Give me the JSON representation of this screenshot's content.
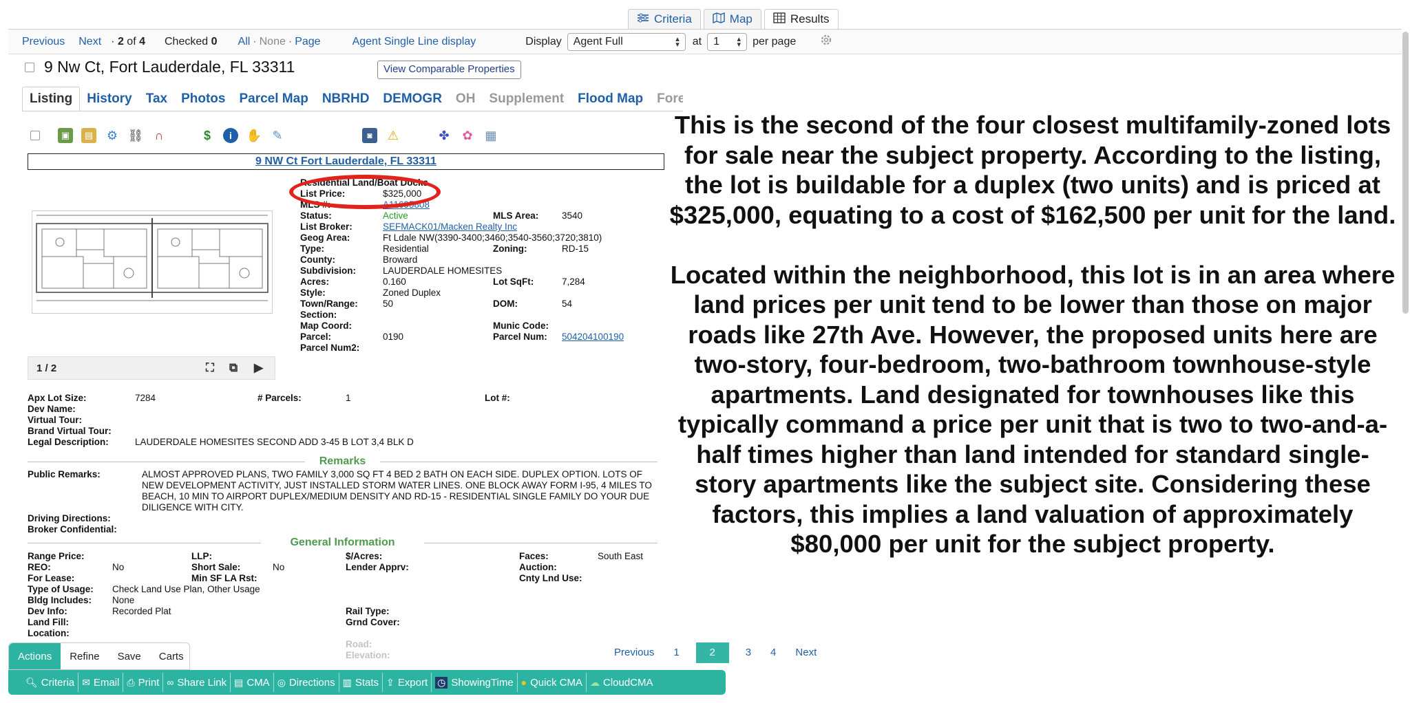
{
  "view_tabs": [
    {
      "label": "Criteria",
      "icon": "sliders-icon"
    },
    {
      "label": "Map",
      "icon": "map-icon"
    },
    {
      "label": "Results",
      "icon": "table-icon"
    }
  ],
  "nav": {
    "previous": "Previous",
    "next": "Next",
    "position_prefix": "·",
    "position_current": "2",
    "position_of": "of",
    "position_total": "4",
    "checked_label": "Checked",
    "checked_count": "0",
    "select_all": "All",
    "select_none": "None",
    "select_page": "Page",
    "dot": "·",
    "single_line": "Agent Single Line display",
    "display_label": "Display",
    "display_value": "Agent Full",
    "at_label": "at",
    "per_page_value": "1",
    "per_page_label": "per page"
  },
  "property": {
    "address": "9 Nw Ct, Fort Lauderdale, FL 33311",
    "comparable_button": "View Comparable Properties",
    "report_title": "9 NW Ct Fort Lauderdale, FL 33311"
  },
  "listing_tabs": [
    "Listing",
    "History",
    "Tax",
    "Photos",
    "Parcel Map",
    "NBRHD",
    "DEMOGR",
    "OH",
    "Supplement",
    "Flood Map",
    "Forecl"
  ],
  "details": {
    "heading": "Residential Land/Boat Docks",
    "list_price_label": "List Price:",
    "list_price": "$325,000",
    "mls_label": "MLS #:",
    "mls": "A11695808",
    "status_label": "Status:",
    "status": "Active",
    "mls_area_label": "MLS Area:",
    "mls_area": "3540",
    "broker_label": "List Broker:",
    "broker": "SEFMACK01/Macken Realty Inc",
    "geog_label": "Geog Area:",
    "geog": "Ft Ldale NW(3390-3400;3460;3540-3560;3720;3810)",
    "type_label": "Type:",
    "type": "Residential",
    "zoning_label": "Zoning:",
    "zoning": "RD-15",
    "county_label": "County:",
    "county": "Broward",
    "subdivision_label": "Subdivision:",
    "subdivision": "LAUDERDALE HOMESITES",
    "acres_label": "Acres:",
    "acres": "0.160",
    "lot_sqft_label": "Lot SqFt:",
    "lot_sqft": "7,284",
    "style_label": "Style:",
    "style": "Zoned Duplex",
    "town_label": "Town/Range:",
    "town": "50",
    "dom_label": "DOM:",
    "dom": "54",
    "section_label": "Section:",
    "map_coord_label": "Map Coord:",
    "munic_label": "Munic Code:",
    "parcel_label": "Parcel:",
    "parcel": "0190",
    "parcel_num_label": "Parcel Num:",
    "parcel_num": "504204100190",
    "parcel_num2_label": "Parcel Num2:"
  },
  "photo": {
    "counter": "1 / 2"
  },
  "lot_info": {
    "apx_label": "Apx Lot Size:",
    "apx": "7284",
    "parcels_label": "# Parcels:",
    "parcels": "1",
    "lot_no_label": "Lot #:",
    "dev_name_label": "Dev Name:",
    "virtual_label": "Virtual Tour:",
    "brand_virtual_label": "Brand Virtual Tour:",
    "legal_label": "Legal Description:",
    "legal": "LAUDERDALE HOMESITES SECOND ADD 3-45 B LOT 3,4 BLK D"
  },
  "remarks": {
    "heading": "Remarks",
    "public_label": "Public Remarks:",
    "public": "ALMOST APPROVED PLANS, TWO FAMILY 3,000 SQ FT 4 BED 2 BATH ON EACH SIDE. DUPLEX OPTION. LOTS OF NEW DEVELOPMENT ACTIVITY, JUST INSTALLED STORM WATER LINES. ONE BLOCK AWAY FORM I-95, 4 MILES TO BEACH, 10 MIN TO AIRPORT DUPLEX/MEDIUM DENSITY AND RD-15 - RESIDENTIAL SINGLE FAMILY DO YOUR DUE DILIGENCE WITH CITY.",
    "driving_label": "Driving Directions:",
    "broker_conf_label": "Broker Confidential:"
  },
  "general": {
    "heading": "General Information",
    "range_price_label": "Range Price:",
    "llp_label": "LLP:",
    "per_acre_label": "$/Acres:",
    "faces_label": "Faces:",
    "faces": "South East",
    "reo_label": "REO:",
    "reo": "No",
    "short_sale_label": "Short Sale:",
    "short_sale": "No",
    "lender_label": "Lender Apprv:",
    "auction_label": "Auction:",
    "for_lease_label": "For Lease:",
    "min_sf_label": "Min SF LA Rst:",
    "cnty_lnd_label": "Cnty Lnd Use:",
    "usage_label": "Type of Usage:",
    "usage": "Check Land Use Plan, Other Usage",
    "bldg_label": "Bldg Includes:",
    "bldg": "None",
    "dev_info_label": "Dev Info:",
    "dev_info": "Recorded Plat",
    "rail_label": "Rail Type:",
    "land_fill_label": "Land Fill:",
    "grnd_label": "Grnd Cover:",
    "location_label": "Location:",
    "road_label": "Road:",
    "elevation_label": "Elevation:"
  },
  "overlay": {
    "paragraph1": "This is the second of the four closest multifamily-zoned lots for sale near the subject property. According to the listing, the lot is buildable for a duplex (two units) and is priced at $325,000, equating to a cost of $162,500 per unit for the land.",
    "paragraph2": "Located within the neighborhood, this lot is in an area where land prices per unit tend to be lower than those on major roads like 27th Ave. However, the proposed units here are two-story, four-bedroom, two-bathroom townhouse-style apartments. Land designated for townhouses like this typically command a price per unit that is two to two-and-a-half times higher than land intended for standard single-story apartments like the subject site. Considering these factors, this implies a land valuation of approximately $80,000 per unit for the subject property."
  },
  "pager": {
    "previous": "Previous",
    "pages": [
      "1",
      "2",
      "3",
      "4"
    ],
    "current": "2",
    "next": "Next"
  },
  "actions": {
    "tabs": [
      "Actions",
      "Refine",
      "Save",
      "Carts"
    ],
    "buttons": [
      {
        "label": "Criteria",
        "icon": "magnifier-icon"
      },
      {
        "label": "Email",
        "icon": "email-icon"
      },
      {
        "label": "Print",
        "icon": "printer-icon"
      },
      {
        "label": "Share Link",
        "icon": "link-icon"
      },
      {
        "label": "CMA",
        "icon": "cma-icon"
      },
      {
        "label": "Directions",
        "icon": "compass-icon"
      },
      {
        "label": "Stats",
        "icon": "stats-icon"
      },
      {
        "label": "Export",
        "icon": "export-icon"
      },
      {
        "label": "ShowingTime",
        "icon": "showingtime-icon"
      },
      {
        "label": "Quick CMA",
        "icon": "quick-cma-icon"
      },
      {
        "label": "CloudCMA",
        "icon": "cloud-icon"
      }
    ]
  },
  "colors": {
    "accent": "#2db3a2",
    "link": "#1f5fa8",
    "highlight": "#e0241d"
  }
}
